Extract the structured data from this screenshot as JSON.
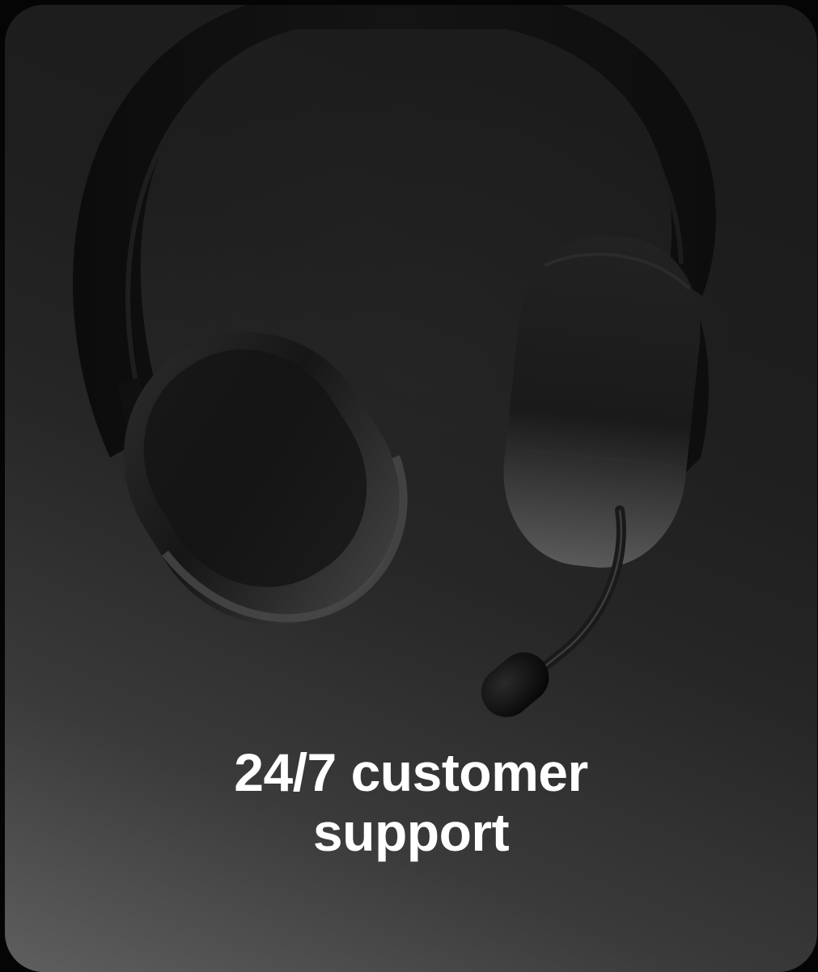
{
  "card": {
    "image_icon": "headset-with-microphone",
    "caption_line1": "24/7 customer",
    "caption_line2": "support"
  },
  "colors": {
    "page_background": "#050505",
    "card_gradient_light": "#5f5f5f",
    "card_gradient_dark": "#1b1b1b",
    "caption_text": "#ffffff"
  }
}
